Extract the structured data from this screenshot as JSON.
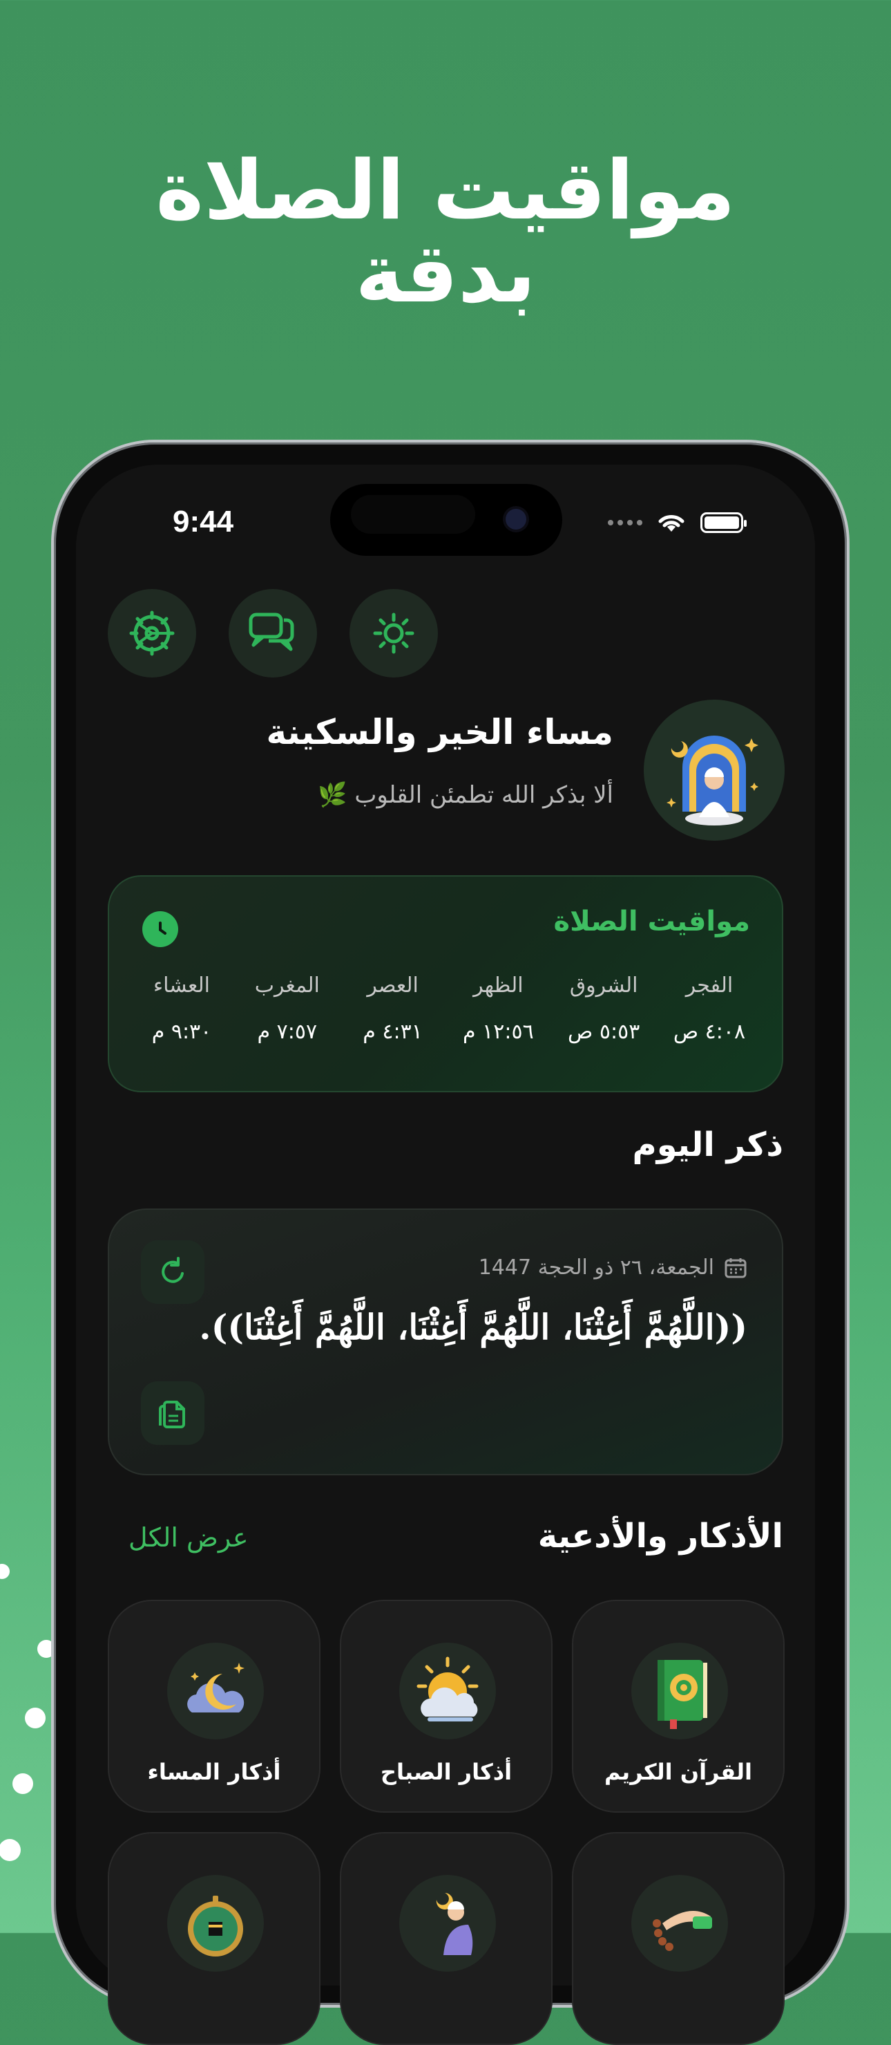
{
  "headline": {
    "line1": "مواقيت الصلاة",
    "line2": "بدقة"
  },
  "status_bar": {
    "time": "9:44"
  },
  "top_buttons": [
    {
      "icon": "settings-icon"
    },
    {
      "icon": "chat-icon"
    },
    {
      "icon": "theme-icon"
    }
  ],
  "greeting": {
    "title": "مساء الخير والسكينة",
    "subtitle": "ألا بذكر الله تطمئن القلوب 🌿"
  },
  "prayer_card": {
    "title": "مواقيت الصلاة",
    "prayers": [
      {
        "name": "الفجر",
        "time": "٤:٠٨ ص"
      },
      {
        "name": "الشروق",
        "time": "٥:٥٣ ص"
      },
      {
        "name": "الظهر",
        "time": "١٢:٥٦ م"
      },
      {
        "name": "العصر",
        "time": "٤:٣١ م"
      },
      {
        "name": "المغرب",
        "time": "٧:٥٧ م"
      },
      {
        "name": "العشاء",
        "time": "٩:٣٠ م"
      }
    ],
    "accent": "#3fbf62"
  },
  "daily_zikr": {
    "section_title": "ذكر اليوم",
    "date": "الجمعة، ٢٦ ذو الحجة 1447",
    "text": "((اللَّهُمَّ أَغِثْنَا، اللَّهُمَّ أَغِثْنَا، اللَّهُمَّ أَغِثْنَا)).",
    "refresh_icon": "refresh-icon",
    "copy_icon": "copy-icon"
  },
  "adhkar_section": {
    "title": "الأذكار والأدعية",
    "view_all": "عرض الكل",
    "tiles": [
      {
        "label": "القرآن الكريم",
        "icon": "quran-icon"
      },
      {
        "label": "أذكار الصباح",
        "icon": "sun-cloud-icon"
      },
      {
        "label": "أذكار المساء",
        "icon": "moon-cloud-icon"
      },
      {
        "label": "",
        "icon": "tasbih-icon"
      },
      {
        "label": "",
        "icon": "praying-man-icon"
      },
      {
        "label": "",
        "icon": "qibla-compass-icon"
      }
    ]
  }
}
